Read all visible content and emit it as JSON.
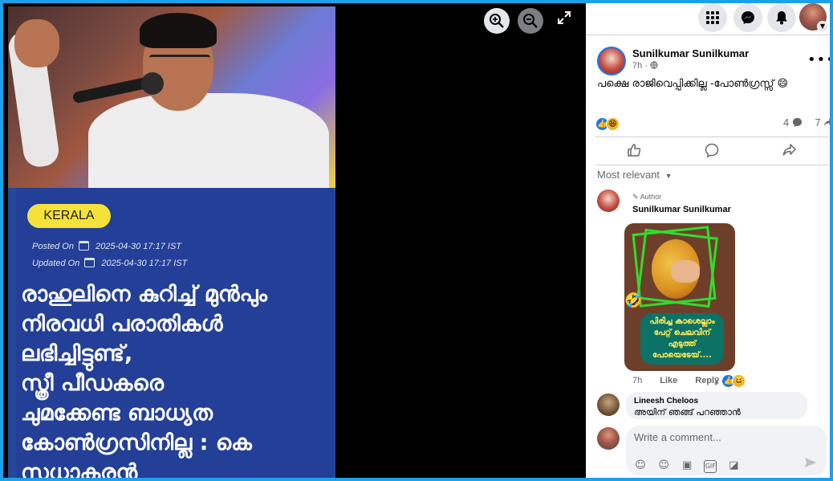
{
  "viewer": {
    "article": {
      "tag": "KERALA",
      "posted_label": "Posted On",
      "posted_value": "2025-04-30 17:17 IST",
      "updated_label": "Updated On",
      "updated_value": "2025-04-30 17:17 IST",
      "headline_lines": [
        "രാഹുലിനെ കുറിച്ച് മുൻപും",
        "നിരവധി പരാതികൾ",
        "ലഭിച്ചിട്ടുണ്ട്,",
        "സ്ത്രീ പീഡകരെ",
        "ചുമക്കേണ്ട ബാധ്യത",
        "കോൺഗ്രസിനില്ല : കെ",
        "സുധാകരൻ"
      ]
    },
    "icons": {
      "zoom_in": "zoom-in-icon",
      "zoom_out": "zoom-out-icon",
      "expand": "expand-icon"
    }
  },
  "topbar": {
    "icons": [
      "menu-grid-icon",
      "messenger-icon",
      "bell-icon"
    ]
  },
  "post": {
    "author": "Sunilkumar Sunilkumar",
    "time": "7h",
    "audience_icon": "globe-icon",
    "caption": "പക്ഷെ രാജിവെപ്പിക്കില്ല -പോൺഗ്രസ്സ് 😄",
    "comment_count": "4",
    "share_count": "7",
    "reaction_icons": [
      "like-icon",
      "haha-icon"
    ]
  },
  "comments": {
    "sort_label": "Most relevant",
    "items": [
      {
        "badge": "Author",
        "name": "Sunilkumar Sunilkumar",
        "sticker_text": "പിരിച്ച കാശെല്ലാം പേറ്റ് ചെലവിന് എടുത്ത് പോയെടേയ്....",
        "time": "7h",
        "like": "Like",
        "reply": "Reply",
        "reaction_count": "2"
      },
      {
        "name": "Lineesh Cheloos",
        "text": "അയിന് ഞങ്ങ് പറഞ്ഞാൻ"
      }
    ]
  },
  "composer": {
    "placeholder": "Write a comment..."
  },
  "colors": {
    "accent": "#1877f2",
    "border": "#1ba0ea",
    "headline_bg": "#233f97",
    "tag": "#f4e23a"
  }
}
